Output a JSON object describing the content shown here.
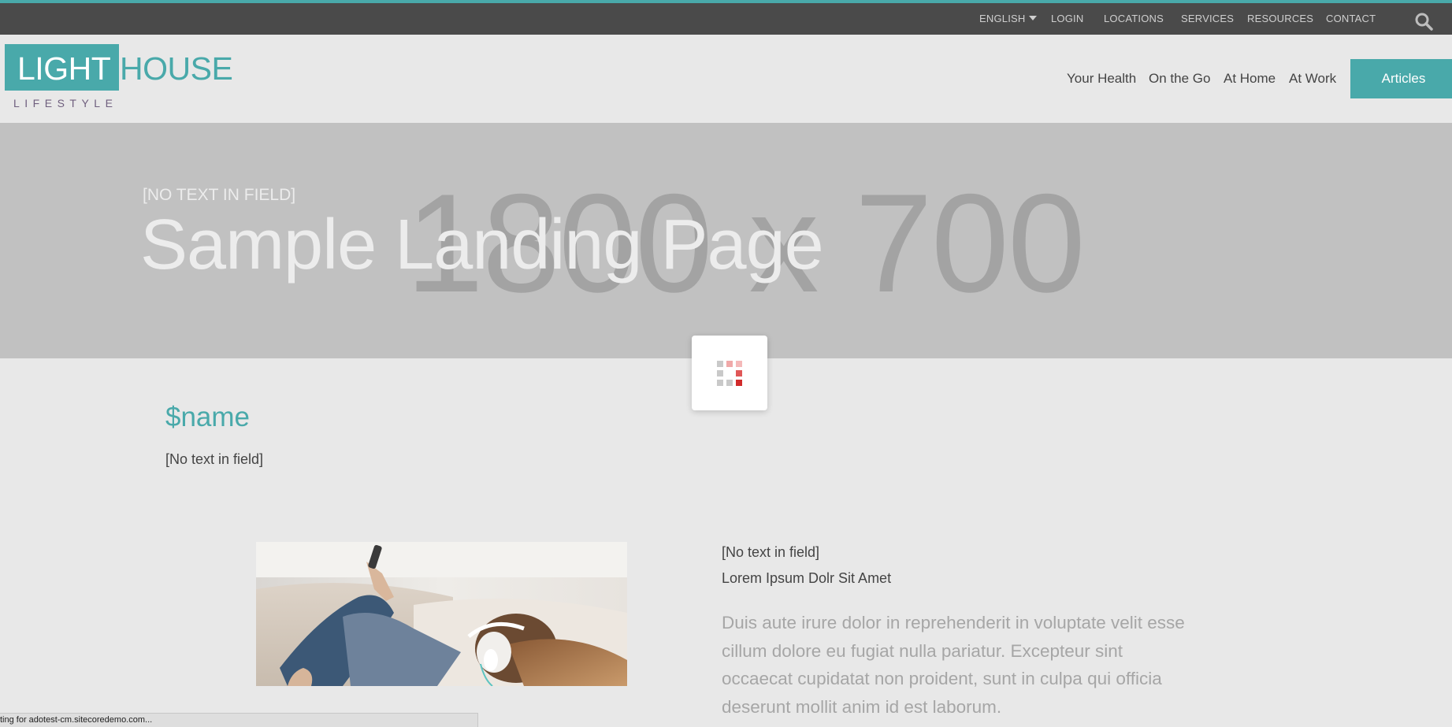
{
  "utility_nav": {
    "language": "ENGLISH",
    "links": [
      "LOGIN",
      "LOCATIONS",
      "SERVICES",
      "RESOURCES",
      "CONTACT"
    ]
  },
  "logo": {
    "light": "LIGHT",
    "house": "HOUSE",
    "tagline": "LIFESTYLE"
  },
  "main_nav": {
    "items": [
      "Your Health",
      "On the Go",
      "At Home",
      "At Work"
    ],
    "cta": "Articles"
  },
  "hero": {
    "placeholder_size": "1800 x 700",
    "eyebrow": "[NO TEXT IN FIELD]",
    "title": "Sample Landing Page"
  },
  "section": {
    "heading": "$name",
    "text": "[No text in field]"
  },
  "feature": {
    "label": "[No text in field]",
    "subtitle": "Lorem Ipsum Dolr Sit Amet",
    "body": "Duis aute irure dolor in reprehenderit in voluptate velit esse cillum dolore eu fugiat nulla pariatur. Excepteur sint occaecat cupidatat non proident, sunt in culpa qui officia deserunt mollit anim id est laborum."
  },
  "status_bar": {
    "text": "ting for adotest-cm.sitecoredemo.com..."
  },
  "colors": {
    "brand_teal": "#49a9aa",
    "utility_bar": "#4a4a4a",
    "hero_bg": "#c1c1c1",
    "page_bg": "#e8e8e8"
  }
}
